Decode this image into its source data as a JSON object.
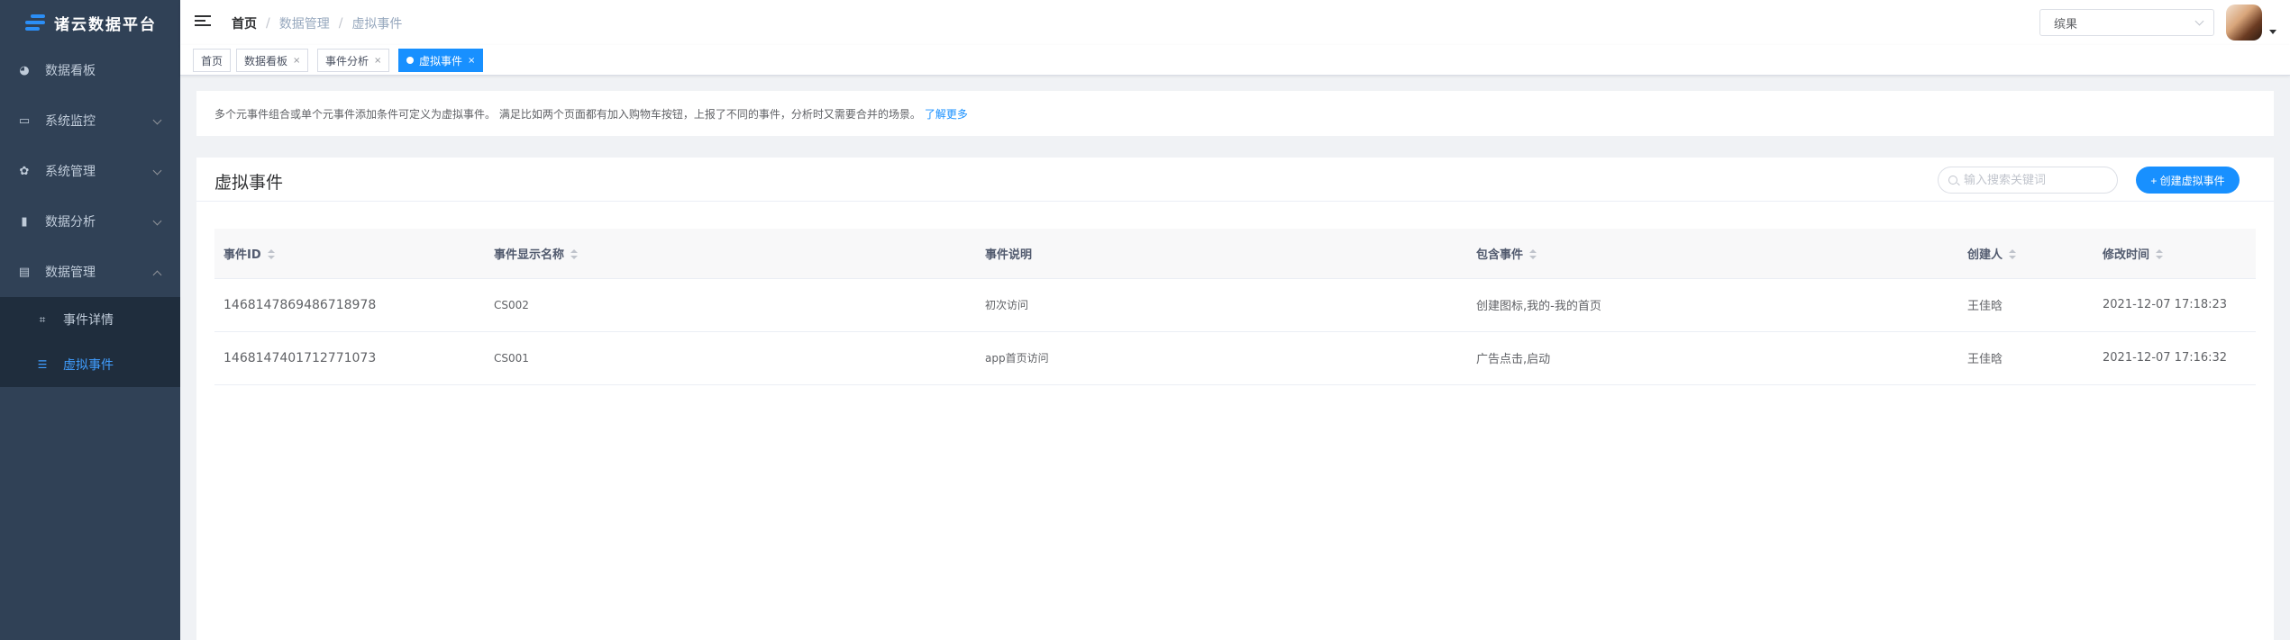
{
  "logo": {
    "title": "诸云数据平台"
  },
  "sidebar": {
    "items": [
      {
        "label": "数据看板",
        "icon": "dashboard-icon",
        "glyph": "◕"
      },
      {
        "label": "系统监控",
        "icon": "monitor-icon",
        "glyph": "▭"
      },
      {
        "label": "系统管理",
        "icon": "gear-icon",
        "glyph": "✿"
      },
      {
        "label": "数据分析",
        "icon": "bar-chart-icon",
        "glyph": "▮"
      },
      {
        "label": "数据管理",
        "icon": "data-icon",
        "glyph": "▤"
      }
    ],
    "sub_items": [
      {
        "label": "事件详情",
        "icon": "tree-icon",
        "glyph": "⌗"
      },
      {
        "label": "虚拟事件",
        "icon": "list-icon",
        "glyph": "☰"
      }
    ]
  },
  "breadcrumb": {
    "home": "首页",
    "level1": "数据管理",
    "level2": "虚拟事件"
  },
  "header": {
    "select_value": "缤果"
  },
  "tags": [
    {
      "label": "首页"
    },
    {
      "label": "数据看板",
      "close": "×"
    },
    {
      "label": "事件分析",
      "close": "×"
    },
    {
      "label": "虚拟事件",
      "close": "×"
    }
  ],
  "info": {
    "text": "多个元事件组合或单个元事件添加条件可定义为虚拟事件。 满足比如两个页面都有加入购物车按钮，上报了不同的事件，分析时又需要合并的场景。",
    "link": "了解更多"
  },
  "card": {
    "title": "虚拟事件",
    "search_placeholder": "输入搜索关键词",
    "create_button": "+ 创建虚拟事件"
  },
  "table": {
    "headers": [
      "事件ID",
      "事件显示名称",
      "事件说明",
      "包含事件",
      "创建人",
      "修改时间"
    ],
    "rows": [
      [
        "1468147869486718978",
        "CS002",
        "初次访问",
        "创建图标,我的-我的首页",
        "王佳晗",
        "2021-12-07 17:18:23"
      ],
      [
        "1468147401712771073",
        "CS001",
        "app首页访问",
        "广告点击,启动",
        "王佳晗",
        "2021-12-07 17:16:32"
      ]
    ]
  },
  "colors": {
    "sidebar_bg": "#304156",
    "accent": "#1890ff",
    "active_menu": "#409eff"
  }
}
